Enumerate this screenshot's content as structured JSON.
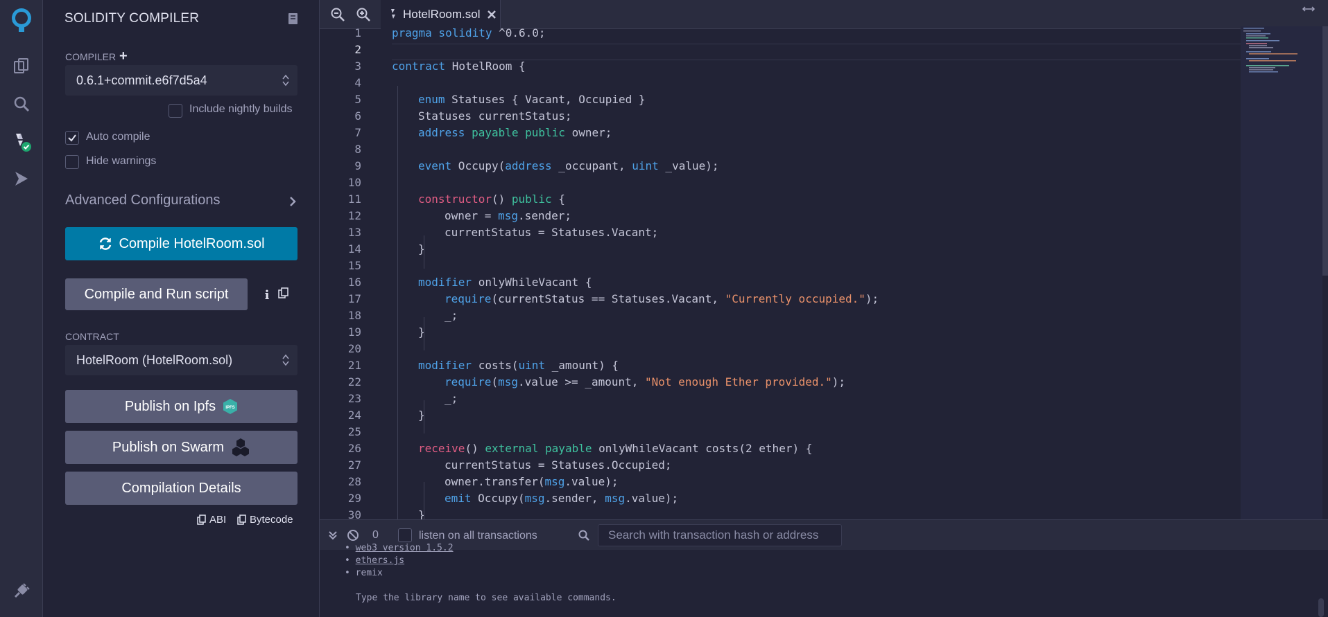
{
  "sidebar": {
    "title": "SOLIDITY COMPILER",
    "compiler_label": "COMPILER",
    "compiler_version": "0.6.1+commit.e6f7d5a4",
    "nightly_label": "Include nightly builds",
    "auto_compile_label": "Auto compile",
    "hide_warnings_label": "Hide warnings",
    "advanced_label": "Advanced Configurations",
    "compile_button": "Compile HotelRoom.sol",
    "run_script_button": "Compile and Run script",
    "contract_label": "CONTRACT",
    "contract_value": "HotelRoom (HotelRoom.sol)",
    "publish_ipfs": "Publish on Ipfs",
    "ipfs_badge": "IPFS",
    "publish_swarm": "Publish on Swarm",
    "compilation_details": "Compilation Details",
    "abi_label": "ABI",
    "bytecode_label": "Bytecode"
  },
  "editor": {
    "tab_name": "HotelRoom.sol",
    "lines": [
      {
        "n": "1"
      },
      {
        "n": "2"
      },
      {
        "n": "3"
      },
      {
        "n": "4"
      },
      {
        "n": "5"
      },
      {
        "n": "6"
      },
      {
        "n": "7"
      },
      {
        "n": "8"
      },
      {
        "n": "9"
      },
      {
        "n": "10"
      },
      {
        "n": "11"
      },
      {
        "n": "12"
      },
      {
        "n": "13"
      },
      {
        "n": "14"
      },
      {
        "n": "15"
      },
      {
        "n": "16"
      },
      {
        "n": "17"
      },
      {
        "n": "18"
      },
      {
        "n": "19"
      },
      {
        "n": "20"
      },
      {
        "n": "21"
      },
      {
        "n": "22"
      },
      {
        "n": "23"
      },
      {
        "n": "24"
      },
      {
        "n": "25"
      },
      {
        "n": "26"
      },
      {
        "n": "27"
      },
      {
        "n": "28"
      },
      {
        "n": "29"
      },
      {
        "n": "30"
      }
    ],
    "code": {
      "l1a": "pragma solidity",
      "l1b": " ^0.6.0;",
      "l3a": "contract",
      "l3b": " HotelRoom {",
      "l5a": "enum",
      "l5b": " Statuses { Vacant, Occupied }",
      "l6": "Statuses currentStatus;",
      "l7a": "address",
      "l7b": " payable public",
      "l7c": " owner;",
      "l9a": "event",
      "l9b": " Occupy(",
      "l9c": "address",
      "l9d": " _occupant, ",
      "l9e": "uint",
      "l9f": " _value);",
      "l11a": "constructor",
      "l11b": "() ",
      "l11c": "public",
      "l11d": " {",
      "l12a": "owner = ",
      "l12b": "msg",
      "l12c": ".sender;",
      "l13": "currentStatus = Statuses.Vacant;",
      "l14": "}",
      "l16a": "modifier",
      "l16b": " onlyWhileVacant {",
      "l17a": "require",
      "l17b": "(currentStatus == Statuses.Vacant, ",
      "l17c": "\"Currently occupied.\"",
      "l17d": ");",
      "l18": "_;",
      "l19": "}",
      "l21a": "modifier",
      "l21b": " costs(",
      "l21c": "uint",
      "l21d": " _amount) {",
      "l22a": "require",
      "l22b": "(",
      "l22c": "msg",
      "l22d": ".value >= _amount, ",
      "l22e": "\"Not enough Ether provided.\"",
      "l22f": ");",
      "l23": "_;",
      "l24": "}",
      "l26a": "receive",
      "l26b": "() ",
      "l26c": "external payable",
      "l26d": " onlyWhileVacant costs(2 ether) {",
      "l27": "currentStatus = Statuses.Occupied;",
      "l28a": "owner.transfer(",
      "l28b": "msg",
      "l28c": ".value);",
      "l29a": "emit",
      "l29b": " Occupy(",
      "l29c": "msg",
      "l29d": ".sender, ",
      "l29e": "msg",
      "l29f": ".value);",
      "l30": "}"
    }
  },
  "terminal": {
    "count": "0",
    "listen_label": "listen on all transactions",
    "search_placeholder": "Search with transaction hash or address",
    "libs": [
      "web3 version 1.5.2",
      "ethers.js",
      "remix"
    ],
    "hint": "Type the library name to see available commands."
  },
  "colors": {
    "accent": "#007aa6",
    "secondary_button": "#595c76",
    "success_badge": "#1ea76f"
  }
}
